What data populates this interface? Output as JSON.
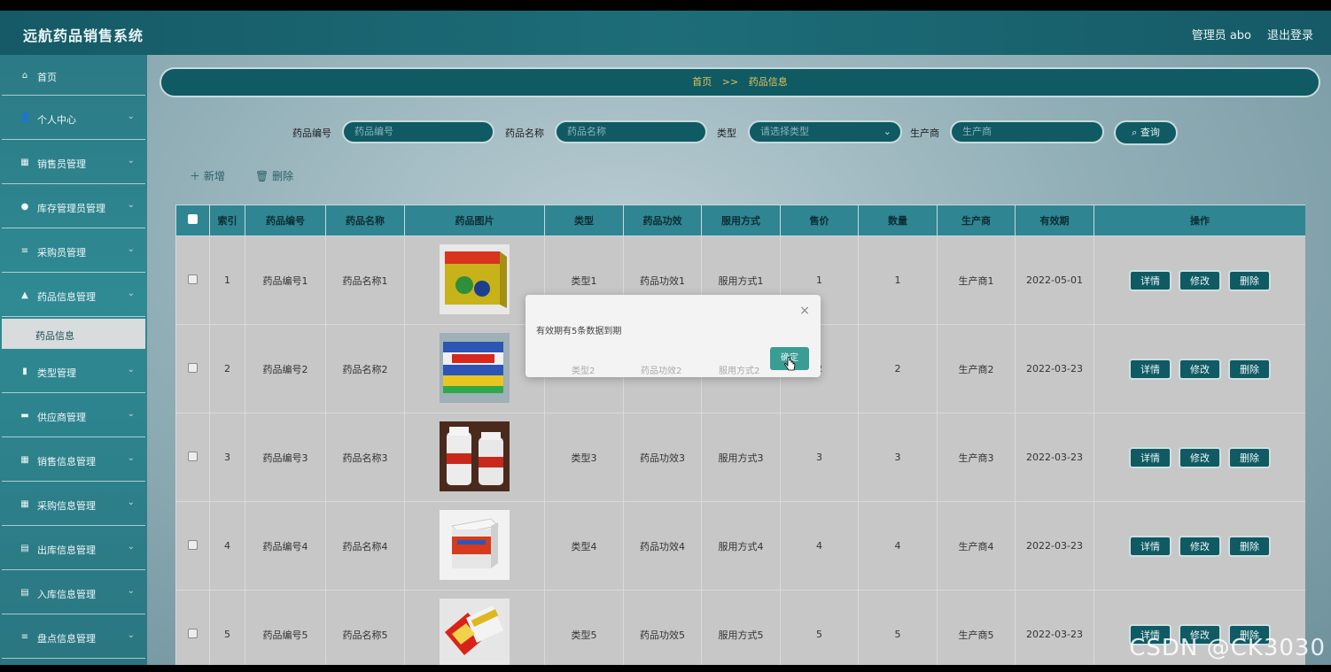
{
  "header": {
    "title": "远航药品销售系统",
    "user": "管理员 abo",
    "logout": "退出登录"
  },
  "sidebar": {
    "items": [
      {
        "label": "首页",
        "icon": "home-icon",
        "glyph": "⌂",
        "expandable": false
      },
      {
        "label": "个人中心",
        "icon": "user-icon",
        "glyph": "👤",
        "expandable": true
      },
      {
        "label": "销售员管理",
        "icon": "grid-icon",
        "glyph": "▦",
        "expandable": true
      },
      {
        "label": "库存管理员管理",
        "icon": "location-icon",
        "glyph": "●",
        "expandable": true
      },
      {
        "label": "采购员管理",
        "icon": "list-icon",
        "glyph": "≡",
        "expandable": true
      },
      {
        "label": "药品信息管理",
        "icon": "bank-icon",
        "glyph": "▲",
        "expandable": true
      },
      {
        "label": "类型管理",
        "icon": "bar-chart-icon",
        "glyph": "▮",
        "expandable": true
      },
      {
        "label": "供应商管理",
        "icon": "briefcase-icon",
        "glyph": "▬",
        "expandable": true
      },
      {
        "label": "销售信息管理",
        "icon": "grid-icon",
        "glyph": "▦",
        "expandable": true
      },
      {
        "label": "采购信息管理",
        "icon": "grid-icon",
        "glyph": "▦",
        "expandable": true
      },
      {
        "label": "出库信息管理",
        "icon": "clipboard-icon",
        "glyph": "▤",
        "expandable": true
      },
      {
        "label": "入库信息管理",
        "icon": "clipboard-icon",
        "glyph": "▤",
        "expandable": true
      },
      {
        "label": "盘点信息管理",
        "icon": "list-icon",
        "glyph": "≡",
        "expandable": true
      }
    ],
    "active_sub": "药品信息",
    "chevron": "⌄"
  },
  "breadcrumb": {
    "home": "首页",
    "sep": ">>",
    "current": "药品信息"
  },
  "search": {
    "code_label": "药品编号",
    "code_placeholder": "药品编号",
    "name_label": "药品名称",
    "name_placeholder": "药品名称",
    "type_label": "类型",
    "type_placeholder": "请选择类型",
    "maker_label": "生产商",
    "maker_placeholder": "生产商",
    "query": "查询"
  },
  "toolbar": {
    "add": "新增",
    "delete": "删除"
  },
  "table": {
    "headers": [
      "索引",
      "药品编号",
      "药品名称",
      "药品图片",
      "类型",
      "药品功效",
      "服用方式",
      "售价",
      "数量",
      "生产商",
      "有效期",
      "操作"
    ],
    "rows": [
      {
        "index": "1",
        "code": "药品编号1",
        "name": "药品名称1",
        "type": "类型1",
        "effect": "药品功效1",
        "usage": "服用方式1",
        "price": "1",
        "qty": "1",
        "maker": "生产商1",
        "expiry": "2022-05-01"
      },
      {
        "index": "2",
        "code": "药品编号2",
        "name": "药品名称2",
        "type": "类型2",
        "effect": "药品功效2",
        "usage": "服用方式2",
        "price": "2",
        "qty": "2",
        "maker": "生产商2",
        "expiry": "2022-03-23"
      },
      {
        "index": "3",
        "code": "药品编号3",
        "name": "药品名称3",
        "type": "类型3",
        "effect": "药品功效3",
        "usage": "服用方式3",
        "price": "3",
        "qty": "3",
        "maker": "生产商3",
        "expiry": "2022-03-23"
      },
      {
        "index": "4",
        "code": "药品编号4",
        "name": "药品名称4",
        "type": "类型4",
        "effect": "药品功效4",
        "usage": "服用方式4",
        "price": "4",
        "qty": "4",
        "maker": "生产商4",
        "expiry": "2022-03-23"
      },
      {
        "index": "5",
        "code": "药品编号5",
        "name": "药品名称5",
        "type": "类型5",
        "effect": "药品功效5",
        "usage": "服用方式5",
        "price": "5",
        "qty": "5",
        "maker": "生产商5",
        "expiry": "2022-03-23"
      }
    ],
    "btn_detail": "详情",
    "btn_edit": "修改",
    "btn_delete": "删除"
  },
  "dialog": {
    "message": "有效期有5条数据到期",
    "ok": "确定",
    "close": "×"
  },
  "watermark": "CSDN @CK3030"
}
